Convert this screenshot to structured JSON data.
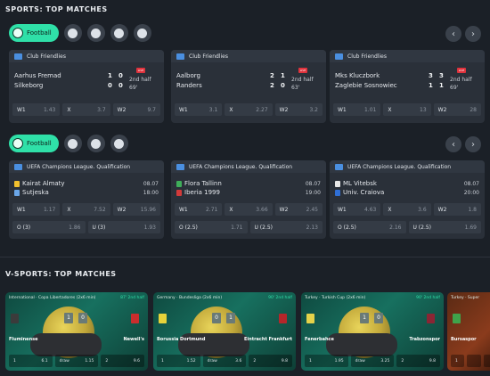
{
  "sports": {
    "title": "SPORTS: TOP MATCHES",
    "tab_label": "Football",
    "nav_prev": "‹",
    "nav_next": "›",
    "live_label": "LIVE",
    "row1": [
      {
        "league": "Club Friendlies",
        "team1": "Aarhus Fremad",
        "team2": "Silkeborg",
        "s1a": "1",
        "s1b": "0",
        "s2a": "0",
        "s2b": "0",
        "period": "2nd half",
        "minute": "69'",
        "odds": [
          {
            "k": "W1",
            "v": "1.43"
          },
          {
            "k": "X",
            "v": "3.7"
          },
          {
            "k": "W2",
            "v": "9.7"
          }
        ]
      },
      {
        "league": "Club Friendlies",
        "team1": "Aalborg",
        "team2": "Randers",
        "s1a": "2",
        "s1b": "1",
        "s2a": "2",
        "s2b": "0",
        "period": "2nd half",
        "minute": "63'",
        "odds": [
          {
            "k": "W1",
            "v": "3.1"
          },
          {
            "k": "X",
            "v": "2.27"
          },
          {
            "k": "W2",
            "v": "3.2"
          }
        ]
      },
      {
        "league": "Club Friendlies",
        "team1": "Mks Kluczbork",
        "team2": "Zaglebie Sosnowiec",
        "s1a": "3",
        "s1b": "3",
        "s2a": "1",
        "s2b": "1",
        "period": "2nd half",
        "minute": "69'",
        "odds": [
          {
            "k": "W1",
            "v": "1.01"
          },
          {
            "k": "X",
            "v": "13"
          },
          {
            "k": "W2",
            "v": "28"
          }
        ]
      }
    ],
    "row2": [
      {
        "league": "UEFA Champions League. Qualification",
        "team1": "Kairat Almaty",
        "team2": "Sutjeska",
        "date": "08.07",
        "time": "18:00",
        "c1": "#f2c12e",
        "c2": "#6aa6e8",
        "odds": [
          {
            "k": "W1",
            "v": "1.17"
          },
          {
            "k": "X",
            "v": "7.52"
          },
          {
            "k": "W2",
            "v": "15.96"
          }
        ],
        "totals": [
          {
            "k": "O (3)",
            "v": "1.86"
          },
          {
            "k": "U (3)",
            "v": "1.93"
          }
        ]
      },
      {
        "league": "UEFA Champions League. Qualification",
        "team1": "Flora Tallinn",
        "team2": "Iberia 1999",
        "date": "08.07",
        "time": "19:00",
        "c1": "#3fae5a",
        "c2": "#d23a3a",
        "odds": [
          {
            "k": "W1",
            "v": "2.71"
          },
          {
            "k": "X",
            "v": "3.66"
          },
          {
            "k": "W2",
            "v": "2.45"
          }
        ],
        "totals": [
          {
            "k": "O (2.5)",
            "v": "1.71"
          },
          {
            "k": "U (2.5)",
            "v": "2.13"
          }
        ]
      },
      {
        "league": "UEFA Champions League. Qualification",
        "team1": "ML Vitebsk",
        "team2": "Univ. Craiova",
        "date": "08.07",
        "time": "20:00",
        "c1": "#e8e8e8",
        "c2": "#2f6fd6",
        "odds": [
          {
            "k": "W1",
            "v": "4.63"
          },
          {
            "k": "X",
            "v": "3.6"
          },
          {
            "k": "W2",
            "v": "1.8"
          }
        ],
        "totals": [
          {
            "k": "O (2.5)",
            "v": "2.16"
          },
          {
            "k": "U (2.5)",
            "v": "1.69"
          }
        ]
      }
    ]
  },
  "vsports": {
    "title": "V-SPORTS: TOP MATCHES",
    "cards": [
      {
        "league": "International · Copa Libertadores (2x6 min)",
        "live": "87' 2nd half",
        "team1": "Fluminense",
        "team2": "Newell's",
        "score1": "1",
        "score2": "0",
        "shirt1": "#3b3b3b",
        "shirt2": "#c92d2d",
        "odds": [
          {
            "k": "1",
            "v": "6.1"
          },
          {
            "k": "draw",
            "v": "1.15"
          },
          {
            "k": "2",
            "v": "9.6"
          }
        ]
      },
      {
        "league": "Germany · Bundesliga (2x6 min)",
        "live": "90' 2nd half",
        "team1": "Borussia Dortmund",
        "team2": "Eintracht Frankfurt",
        "score1": "0",
        "score2": "1",
        "shirt1": "#e7d23a",
        "shirt2": "#b5262a",
        "odds": [
          {
            "k": "1",
            "v": "1.52"
          },
          {
            "k": "draw",
            "v": "3.6"
          },
          {
            "k": "2",
            "v": "9.8"
          }
        ]
      },
      {
        "league": "Turkey · Turkish Cup (2x6 min)",
        "live": "90' 2nd half",
        "team1": "Fenerbahce",
        "team2": "Trabzonspor",
        "score1": "1",
        "score2": "0",
        "shirt1": "#e4d24a",
        "shirt2": "#8a2534",
        "odds": [
          {
            "k": "1",
            "v": "1.95"
          },
          {
            "k": "draw",
            "v": "3.25"
          },
          {
            "k": "2",
            "v": "9.8"
          }
        ]
      },
      {
        "league": "Turkey · Super",
        "live": "",
        "team1": "Bursaspor",
        "team2": "",
        "score1": "",
        "score2": "",
        "shirt1": "#3fa34a",
        "shirt2": "#ffffff",
        "odds": [
          {
            "k": "1",
            "v": ""
          },
          {
            "k": "",
            "v": ""
          },
          {
            "k": "",
            "v": ""
          }
        ]
      }
    ]
  }
}
